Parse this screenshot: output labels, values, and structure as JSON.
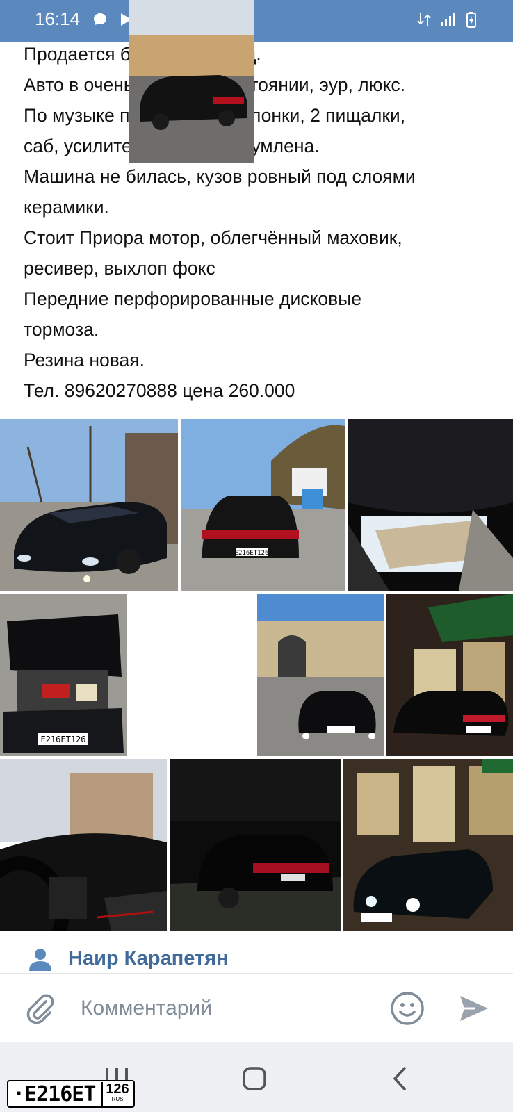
{
  "status_bar": {
    "time": "16:14",
    "left_icons": [
      "chat-bubble-icon",
      "play-icon"
    ],
    "right_icons": [
      "data-arrows-icon",
      "signal-icon",
      "battery-icon"
    ],
    "background": "#5b88bd"
  },
  "post": {
    "lines": [
      "Продается богдан 2012 год.",
      "Авто в очень хорошем состоянии, эур, люкс.",
      "По музыке пионер 88, 4 колонки, 2 пищалки,",
      "саб, усилители, вся обесшумлена.",
      "Машина не билась, кузов ровный под слоями",
      "керамики.",
      "Стоит Приора мотор, облегчённый маховик,",
      "ресивер, выхлоп фокс",
      "Передние перфорированные дисковые",
      "тормоза.",
      "Резина новая.",
      "Тел. 89620270888 цена 260.000"
    ]
  },
  "photos": {
    "count": 10,
    "plate_texts": [
      "Е216ЕТ126",
      "Е216ЕТ 126"
    ]
  },
  "author": {
    "name": "Наир Карапетян",
    "icon": "person-icon",
    "color": "#3f6a9a"
  },
  "comment_bar": {
    "placeholder": "Комментарий",
    "icons": [
      "paperclip-icon",
      "smiley-icon",
      "send-icon"
    ]
  },
  "nav_bar": {
    "icons": [
      "recent-apps-icon",
      "home-icon",
      "back-icon"
    ]
  },
  "plate_overlay": {
    "main": "·Е216ЕТ",
    "region": "126",
    "country": "RUS"
  }
}
